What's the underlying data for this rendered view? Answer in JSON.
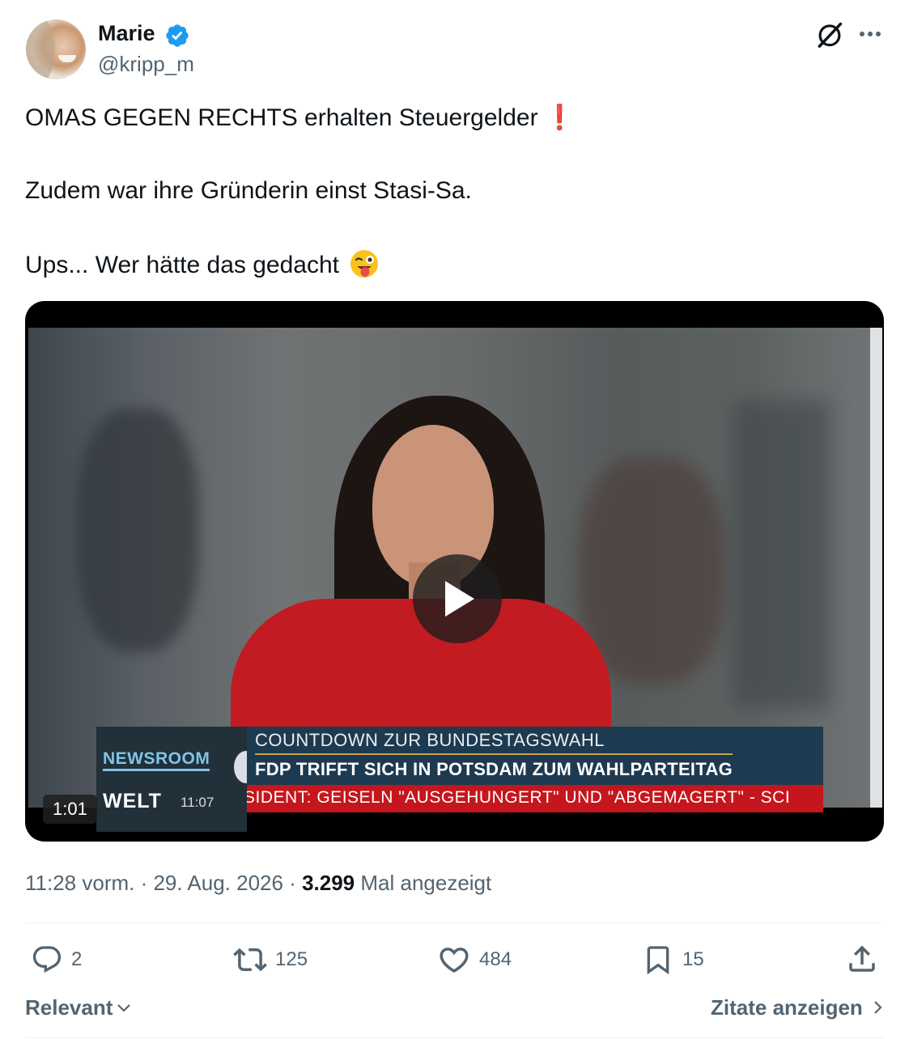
{
  "author": {
    "name": "Marie",
    "handle": "@kripp_m",
    "verified": true
  },
  "tweet": {
    "line1": "OMAS GEGEN RECHTS erhalten Steuergelder",
    "line1_emoji": "❗",
    "line2": "Zudem war ihre Gründerin einst Stasi-Sa.",
    "line3": "Ups... Wer hätte das gedacht",
    "line3_emoji": "😜"
  },
  "video": {
    "duration": "1:01",
    "lower_third": {
      "show": "NEWSROOM",
      "channel": "WELT",
      "time": "11:07",
      "headline": "COUNTDOWN ZUR BUNDESTAGSWAHL",
      "subline": "FDP TRIFFT SICH IN POTSDAM ZUM WAHLPARTEITAG",
      "ticker": "SIDENT: GEISELN \"AUSGEHUNGERT\" UND \"ABGEMAGERT\" - SCI"
    }
  },
  "meta": {
    "timestamp": "11:28 vorm. · 29. Aug. 2026 · ",
    "views": "3.299",
    "views_label": " Mal angezeigt"
  },
  "actions": {
    "replies": "2",
    "reposts": "125",
    "likes": "484",
    "bookmarks": "15"
  },
  "footer": {
    "sort_label": "Relevant",
    "quotes_label": "Zitate anzeigen"
  },
  "icons": {
    "verified": "verified-badge-icon",
    "grok": "grok-icon",
    "more": "more-icon",
    "play": "play-icon",
    "reply": "reply-icon",
    "repost": "repost-icon",
    "like": "like-icon",
    "bookmark": "bookmark-icon",
    "share": "share-icon"
  },
  "colors": {
    "verified_blue": "#1d9bf0",
    "text_primary": "#0f1419",
    "text_secondary": "#536471"
  }
}
